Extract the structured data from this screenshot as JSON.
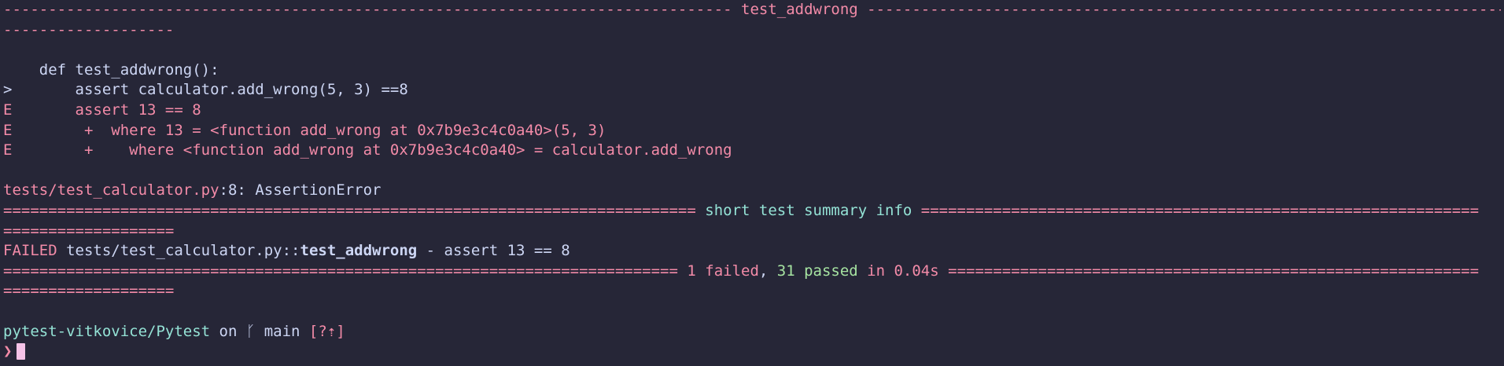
{
  "header": {
    "dash_left": "--------------------------------------------------------------------------------- ",
    "test_name": "test_addwrong",
    "dash_right": " --------------------------------------------------------------------------------",
    "dash_wrap": "-------------------"
  },
  "code": {
    "def_line": "    def test_addwrong():",
    "arrow": ">",
    "assert_line": "       assert calculator.add_wrong(5, 3) ==8",
    "err1_prefix": "E",
    "err1_text": "       assert 13 == 8",
    "err2_prefix": "E",
    "err2_text": "        +  where 13 = <function add_wrong at 0x7b9e3c4c0a40>(5, 3)",
    "err3_prefix": "E",
    "err3_text": "        +    where <function add_wrong at 0x7b9e3c4c0a40> = calculator.add_wrong"
  },
  "error_location": {
    "path": "tests/test_calculator.py",
    "line": ":8:",
    "error": " AssertionError"
  },
  "summary_header": {
    "eq_left": "============================================================================= ",
    "title": "short test summary info",
    "eq_right": " ==============================================================",
    "eq_wrap": "==================="
  },
  "failed_line": {
    "status": "FAILED",
    "path": " tests/test_calculator.py::",
    "test": "test_addwrong",
    "message": " - assert 13 == 8"
  },
  "results": {
    "eq_left": "=========================================================================== ",
    "failed": "1 failed",
    "comma": ", ",
    "passed": "31 passed",
    "time": " in 0.04s",
    "eq_right": " ===========================================================",
    "eq_wrap": "==================="
  },
  "prompt": {
    "dir": "pytest-vitkovice/Pytest",
    "on": " on ",
    "branch_icon": "ᚴ",
    "branch": " main",
    "status": " [?⇡]",
    "symbol": "❯"
  },
  "colors": {
    "background": "#262637",
    "red": "#f38ba8",
    "teal": "#94e2d5",
    "green": "#a6e3a1",
    "foreground": "#cdd6f4",
    "cursor": "#f5c2e7"
  }
}
